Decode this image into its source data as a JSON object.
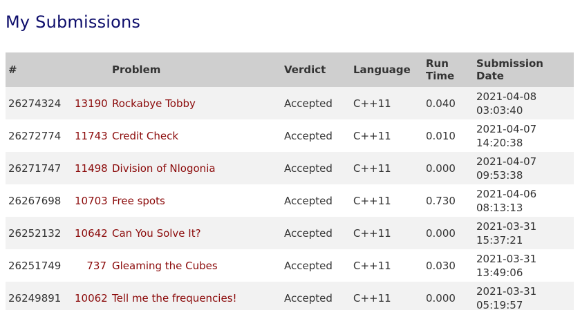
{
  "page": {
    "title": "My Submissions"
  },
  "table": {
    "headers": {
      "id": "#",
      "problem": "Problem",
      "verdict": "Verdict",
      "language": "Language",
      "run_time": "Run Time",
      "submission_date": "Submission Date"
    },
    "rows": [
      {
        "id": "26274324",
        "problem_id": "13190",
        "problem_name": "Rockabye Tobby",
        "verdict": "Accepted",
        "language": "C++11",
        "run_time": "0.040",
        "date": "2021-04-08",
        "time": "03:03:40"
      },
      {
        "id": "26272774",
        "problem_id": "11743",
        "problem_name": "Credit Check",
        "verdict": "Accepted",
        "language": "C++11",
        "run_time": "0.010",
        "date": "2021-04-07",
        "time": "14:20:38"
      },
      {
        "id": "26271747",
        "problem_id": "11498",
        "problem_name": "Division of Nlogonia",
        "verdict": "Accepted",
        "language": "C++11",
        "run_time": "0.000",
        "date": "2021-04-07",
        "time": "09:53:38"
      },
      {
        "id": "26267698",
        "problem_id": "10703",
        "problem_name": "Free spots",
        "verdict": "Accepted",
        "language": "C++11",
        "run_time": "0.730",
        "date": "2021-04-06",
        "time": "08:13:13"
      },
      {
        "id": "26252132",
        "problem_id": "10642",
        "problem_name": "Can You Solve It?",
        "verdict": "Accepted",
        "language": "C++11",
        "run_time": "0.000",
        "date": "2021-03-31",
        "time": "15:37:21"
      },
      {
        "id": "26251749",
        "problem_id": "737",
        "problem_name": "Gleaming the Cubes",
        "verdict": "Accepted",
        "language": "C++11",
        "run_time": "0.030",
        "date": "2021-03-31",
        "time": "13:49:06"
      },
      {
        "id": "26249891",
        "problem_id": "10062",
        "problem_name": "Tell me the frequencies!",
        "verdict": "Accepted",
        "language": "C++11",
        "run_time": "0.000",
        "date": "2021-03-31",
        "time": "05:19:57"
      }
    ]
  },
  "colors": {
    "title": "#0d0d6b",
    "link": "#8b0a0a",
    "header_bg": "#cfcfcf",
    "row_alt_bg": "#f2f2f2"
  }
}
